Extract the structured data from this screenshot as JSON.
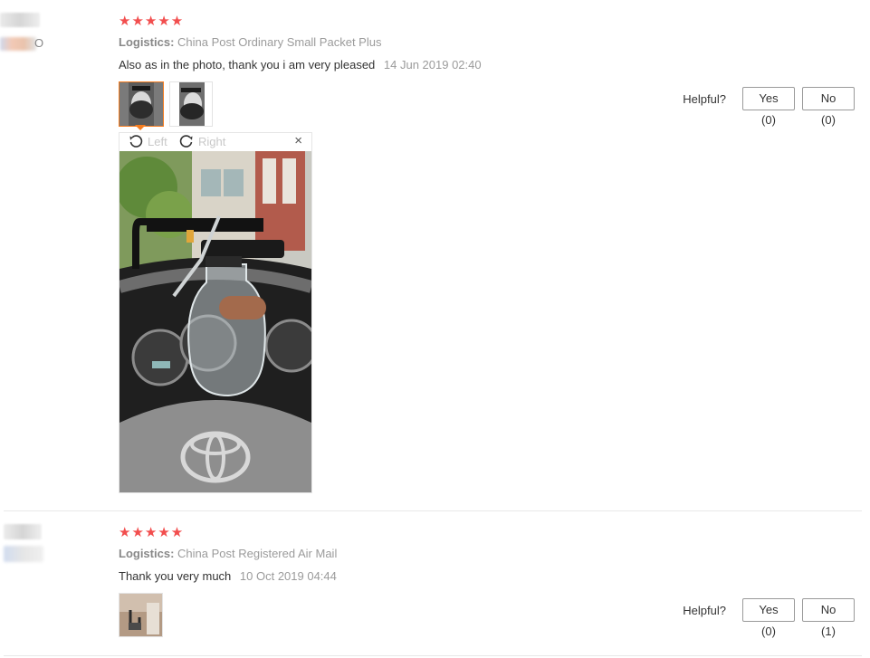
{
  "reviews": [
    {
      "rating_stars": "★★★★★",
      "logistics_label": "Logistics:",
      "logistics_value": "China Post Ordinary Small Packet Plus",
      "text": "Also as in the photo, thank you i am very pleased",
      "date": "14 Jun 2019 02:40",
      "thumbnails": [
        "photo-1",
        "photo-2"
      ],
      "helpful_label": "Helpful?",
      "yes_label": "Yes (0)",
      "no_label": "No (0)"
    },
    {
      "rating_stars": "★★★★★",
      "logistics_label": "Logistics:",
      "logistics_value": "China Post Registered Air Mail",
      "text": "Thank you very much",
      "date": "10 Oct 2019 04:44",
      "thumbnails": [
        "photo-1"
      ],
      "helpful_label": "Helpful?",
      "yes_label": "Yes (0)",
      "no_label": "No (1)"
    }
  ],
  "viewer": {
    "rotate_left_label": "Left",
    "rotate_right_label": "Right",
    "close_symbol": "×"
  },
  "colors": {
    "star": "#f24e4e",
    "active_thumb": "#f57d20"
  },
  "icons": [
    "rotate-left-icon",
    "rotate-right-icon",
    "close-icon",
    "star-icon"
  ]
}
